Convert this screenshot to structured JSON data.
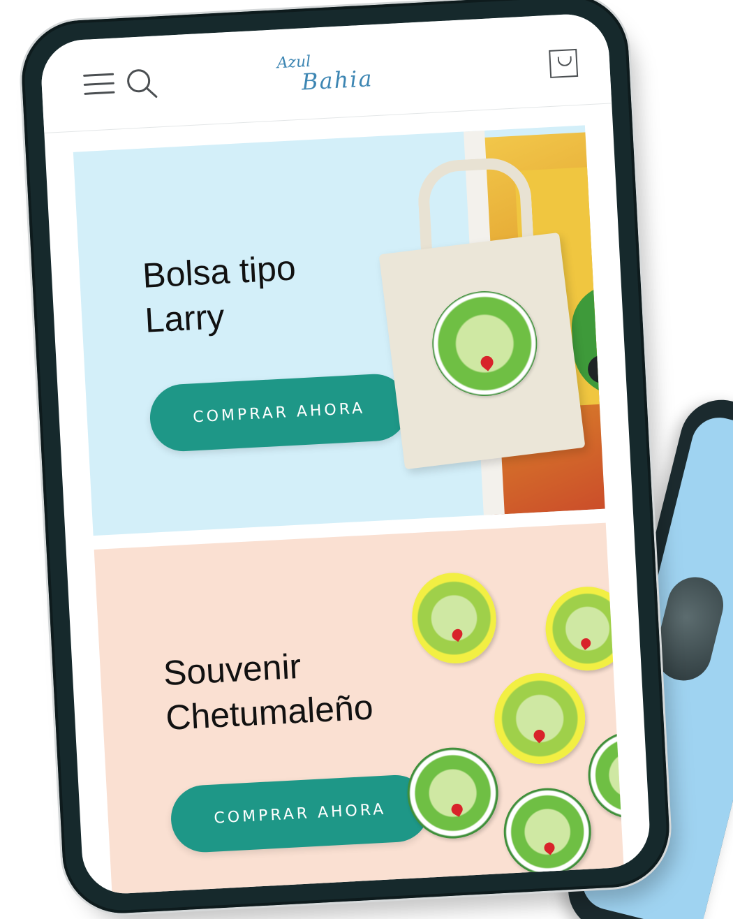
{
  "header": {
    "logo_line1": "Azul",
    "logo_line2": "Bahia",
    "icons": [
      "menu-icon",
      "search-icon",
      "cart-icon"
    ]
  },
  "banners": [
    {
      "title_lines": [
        "Bolsa tipo",
        "Larry"
      ],
      "cta_label": "COMPRAR AHORA",
      "background": "#d3eff9"
    },
    {
      "title_lines": [
        "Souvenir",
        "Chetumaleño"
      ],
      "cta_label": "COMPRAR AHORA",
      "background": "#fae0d2"
    }
  ],
  "colors": {
    "accent": "#1e9787",
    "logo": "#3d86b3",
    "device_frame": "#16292c"
  }
}
